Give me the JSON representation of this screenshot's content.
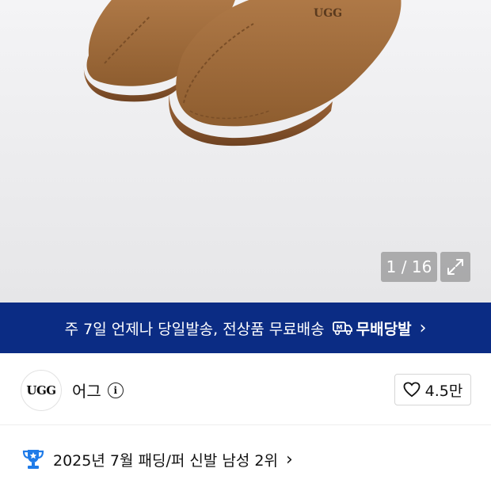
{
  "hero": {
    "logo_text": "UGG",
    "counter": "1 / 16",
    "expand_icon": "expand-icon"
  },
  "banner": {
    "text": "주 7일 언제나 당일발송, 전상품 무료배송",
    "badge_icon": "delivery-truck-icon",
    "badge_label": "무배당발",
    "chevron": "›"
  },
  "brand": {
    "logo_text": "UGG",
    "name": "어그",
    "info_icon": "i",
    "like_count": "4.5만"
  },
  "ranking": {
    "icon": "trophy-icon",
    "text": "2025년 7월 패딩/퍼 신발 남성 2위",
    "chevron": "›"
  },
  "colors": {
    "banner_bg": "#0b2c84",
    "trophy": "#1f7be8",
    "shoe": "#a06a3a"
  }
}
